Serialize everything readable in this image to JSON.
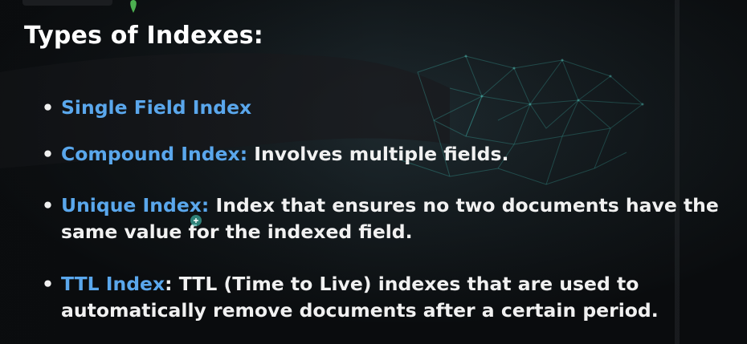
{
  "slide": {
    "title": "Types of Indexes:",
    "items": [
      {
        "term": "Single Field Index",
        "desc": ""
      },
      {
        "term": "Compound Index:",
        "desc": " Involves multiple fields."
      },
      {
        "term": "Unique Index:",
        "desc": " Index that ensures no two documents have the same value for the indexed field."
      },
      {
        "term": "TTL Index",
        "desc": ": TTL (Time to Live) indexes that are used to automatically remove documents after a certain period."
      }
    ]
  },
  "icons": {
    "bullet": "•",
    "logo": "leaf-icon",
    "cursor": "cursor-icon"
  },
  "colors": {
    "term": "#5aa7ec",
    "text": "#f1f1f1",
    "background": "#0b0d0f"
  }
}
